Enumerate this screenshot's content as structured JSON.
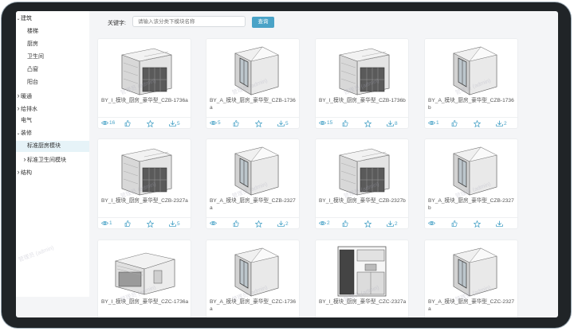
{
  "search": {
    "label": "关键字:",
    "placeholder": "请输入该分类下模块名称",
    "button": "查询"
  },
  "sidebar": {
    "items": [
      {
        "label": "建筑",
        "caret": "expanded"
      },
      {
        "label": "楼梯"
      },
      {
        "label": "厨房"
      },
      {
        "label": "卫生间"
      },
      {
        "label": "凸窗"
      },
      {
        "label": "阳台"
      },
      {
        "label": "暖通",
        "caret": "collapsed"
      },
      {
        "label": "给排水",
        "caret": "collapsed"
      },
      {
        "label": "电气"
      },
      {
        "label": "装修",
        "caret": "expanded"
      },
      {
        "label": "标准厨房模块",
        "selected": true
      },
      {
        "label": "标准卫生间模块",
        "caret": "collapsed"
      },
      {
        "label": "结构",
        "caret": "collapsed"
      }
    ]
  },
  "cards": [
    {
      "title": "BY_I_模块_厨房_豪华型_CZB-1736a",
      "views": "16",
      "downloads": "5",
      "model": "kitchen-front"
    },
    {
      "title": "BY_A_模块_厨房_豪华型_CZB-1736a",
      "views": "5",
      "downloads": "5",
      "model": "room-window"
    },
    {
      "title": "BY_I_模块_厨房_豪华型_CZB-1736b",
      "views": "15",
      "downloads": "8",
      "model": "kitchen-front"
    },
    {
      "title": "BY_A_模块_厨房_豪华型_CZB-1736b",
      "views": "1",
      "downloads": "2",
      "model": "room-window"
    },
    {
      "title": "BY_I_模块_厨房_豪华型_CZB-2327a",
      "views": "1",
      "downloads": "5",
      "model": "kitchen-front"
    },
    {
      "title": "BY_A_模块_厨房_豪华型_CZB-2327a",
      "views": "",
      "downloads": "2",
      "model": "room-window"
    },
    {
      "title": "BY_I_模块_厨房_豪华型_CZB-2327b",
      "views": "2",
      "downloads": "2",
      "model": "kitchen-front"
    },
    {
      "title": "BY_A_模块_厨房_豪华型_CZB-2327b",
      "views": "",
      "downloads": "",
      "model": "room-window"
    },
    {
      "title": "BY_I_模块_厨房_豪华型_CZC-1736a",
      "views": "",
      "downloads": "",
      "model": "kitchen-wide"
    },
    {
      "title": "BY_A_模块_厨房_豪华型_CZC-1736a",
      "views": "",
      "downloads": "",
      "model": "room-window"
    },
    {
      "title": "BY_I_模块_厨房_豪华型_CZC-2327a",
      "views": "",
      "downloads": "",
      "model": "kitchen-elevation"
    },
    {
      "title": "BY_A_模块_厨房_豪华型_CZC-2327a",
      "views": "",
      "downloads": "",
      "model": "room-window"
    }
  ],
  "watermark_text": "管理员 (admin)",
  "colors": {
    "accent": "#4aa3c7",
    "selected_bg": "#e6f3f8",
    "bezel": "#202427"
  }
}
